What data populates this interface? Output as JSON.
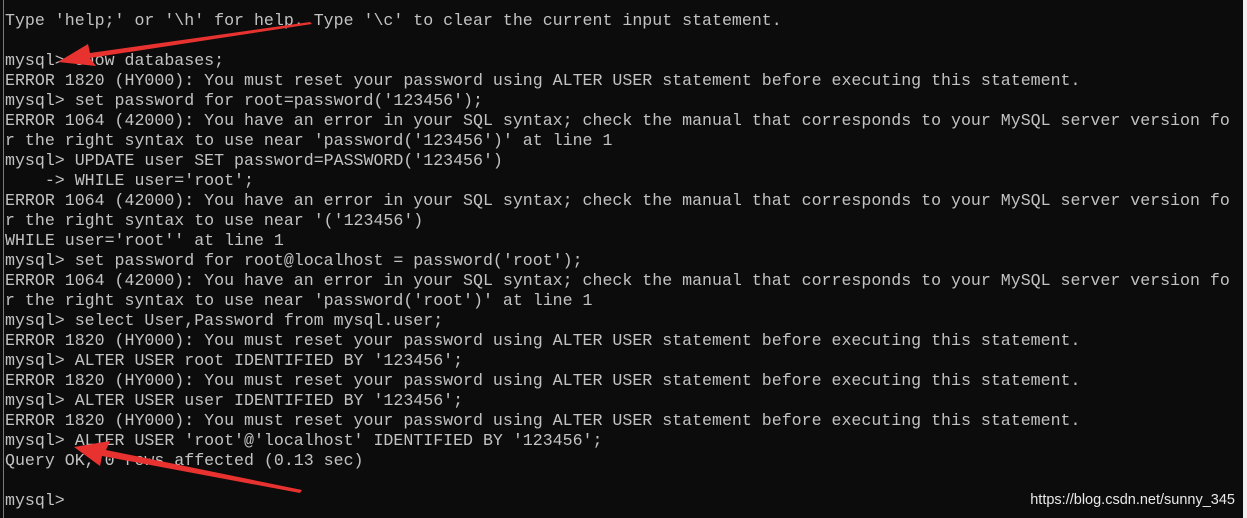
{
  "terminal": {
    "lines": [
      "Type 'help;' or '\\h' for help. Type '\\c' to clear the current input statement.",
      "",
      "mysql> show databases;",
      "ERROR 1820 (HY000): You must reset your password using ALTER USER statement before executing this statement.",
      "mysql> set password for root=password('123456');",
      "ERROR 1064 (42000): You have an error in your SQL syntax; check the manual that corresponds to your MySQL server version fo",
      "r the right syntax to use near 'password('123456')' at line 1",
      "mysql> UPDATE user SET password=PASSWORD('123456')",
      "    -> WHILE user='root';",
      "ERROR 1064 (42000): You have an error in your SQL syntax; check the manual that corresponds to your MySQL server version fo",
      "r the right syntax to use near '('123456')",
      "WHILE user='root'' at line 1",
      "mysql> set password for root@localhost = password('root');",
      "ERROR 1064 (42000): You have an error in your SQL syntax; check the manual that corresponds to your MySQL server version fo",
      "r the right syntax to use near 'password('root')' at line 1",
      "mysql> select User,Password from mysql.user;",
      "ERROR 1820 (HY000): You must reset your password using ALTER USER statement before executing this statement.",
      "mysql> ALTER USER root IDENTIFIED BY '123456';",
      "ERROR 1820 (HY000): You must reset your password using ALTER USER statement before executing this statement.",
      "mysql> ALTER USER user IDENTIFIED BY '123456';",
      "ERROR 1820 (HY000): You must reset your password using ALTER USER statement before executing this statement.",
      "mysql> ALTER USER 'root'@'localhost' IDENTIFIED BY '123456';",
      "Query OK, 0 rows affected (0.13 sec)",
      "",
      "mysql>"
    ]
  },
  "watermark": "https://blog.csdn.net/sunny_345",
  "colors": {
    "background": "#0c0c0c",
    "text": "#c2c2c2",
    "annotation_arrow": "#e8322f"
  }
}
